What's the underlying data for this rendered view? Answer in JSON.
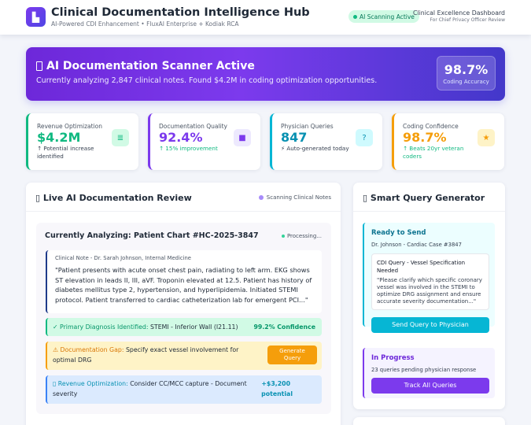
{
  "header": {
    "app_title": "Clinical Documentation Intelligence Hub",
    "app_subtitle": "AI-Powered CDI Enhancement • FluxAI Enterprise + Kodiak RCA",
    "status": "AI Scanning Active",
    "dashboard_title": "Clinical Excellence Dashboard",
    "dashboard_sub": "For Chief Privacy Officer Review"
  },
  "banner": {
    "title": "AI Documentation Scanner Active",
    "text": "Currently analyzing 2,847 clinical notes. Found $4.2M in coding optimization opportunities.",
    "accuracy_value": "98.7%",
    "accuracy_label": "Coding Accuracy"
  },
  "metrics": [
    {
      "label": "Revenue Optimization",
      "value": "$4.2M",
      "note": "↑ Potential increase identified",
      "icon": "list-icon",
      "color": "#10b981"
    },
    {
      "label": "Documentation Quality",
      "value": "92.4%",
      "note": "↑ 15% improvement",
      "icon": "robot-icon",
      "color": "#7c3aed"
    },
    {
      "label": "Physician Queries",
      "value": "847",
      "note": "⚡ Auto-generated today",
      "icon": "question-icon",
      "color": "#06b6d4"
    },
    {
      "label": "Coding Confidence",
      "value": "98.7%",
      "note": "↑ Beats 20yr veteran coders",
      "icon": "star-icon",
      "color": "#f59e0b"
    }
  ],
  "review": {
    "title": "Live AI Documentation Review",
    "scan_tag": "Scanning Clinical Notes",
    "analyzing_title": "Currently Analyzing: Patient Chart #HC-2025-3847",
    "processing": "Processing...",
    "note_header": "Clinical Note - Dr. Sarah Johnson, Internal Medicine",
    "note_body": "\"Patient presents with acute onset chest pain, radiating to left arm. EKG shows ST elevation in leads II, III, aVF. Troponin elevated at 12.5. Patient has history of diabetes mellitus type 2, hypertension, and hyperlipidemia. Initiated STEMI protocol. Patient transferred to cardiac catheterization lab for emergent PCI...\"",
    "findings": {
      "diagnosis_label": "✓ Primary Diagnosis Identified:",
      "diagnosis_text": "STEMI - Inferior Wall (I21.11)",
      "diagnosis_right": "99.2% Confidence",
      "gap_label": "⚠ Documentation Gap:",
      "gap_text": "Specify exact vessel involvement for",
      "gap_text2": "optimal DRG",
      "gap_button_line1": "Generate",
      "gap_button_line2": "Query",
      "revenue_label": "▯ Revenue Optimization:",
      "revenue_text": "Consider CC/MCC capture - Document",
      "revenue_text2": "severity",
      "revenue_right1": "+$3,200",
      "revenue_right2": "potential"
    }
  },
  "query": {
    "title": "Smart Query Generator",
    "ready_title": "Ready to Send",
    "ready_sub": "Dr. Johnson - Cardiac Case #3847",
    "query_title": "CDI Query - Vessel Specification Needed",
    "query_text": "\"Please clarify which specific coronary vessel was involved in the STEMI to optimize DRG assignment and ensure accurate severity documentation...\"",
    "send_label": "Send Query to Physician",
    "progress_title": "In Progress",
    "progress_sub": "23 queries pending physician response",
    "track_label": "Track All Queries"
  }
}
